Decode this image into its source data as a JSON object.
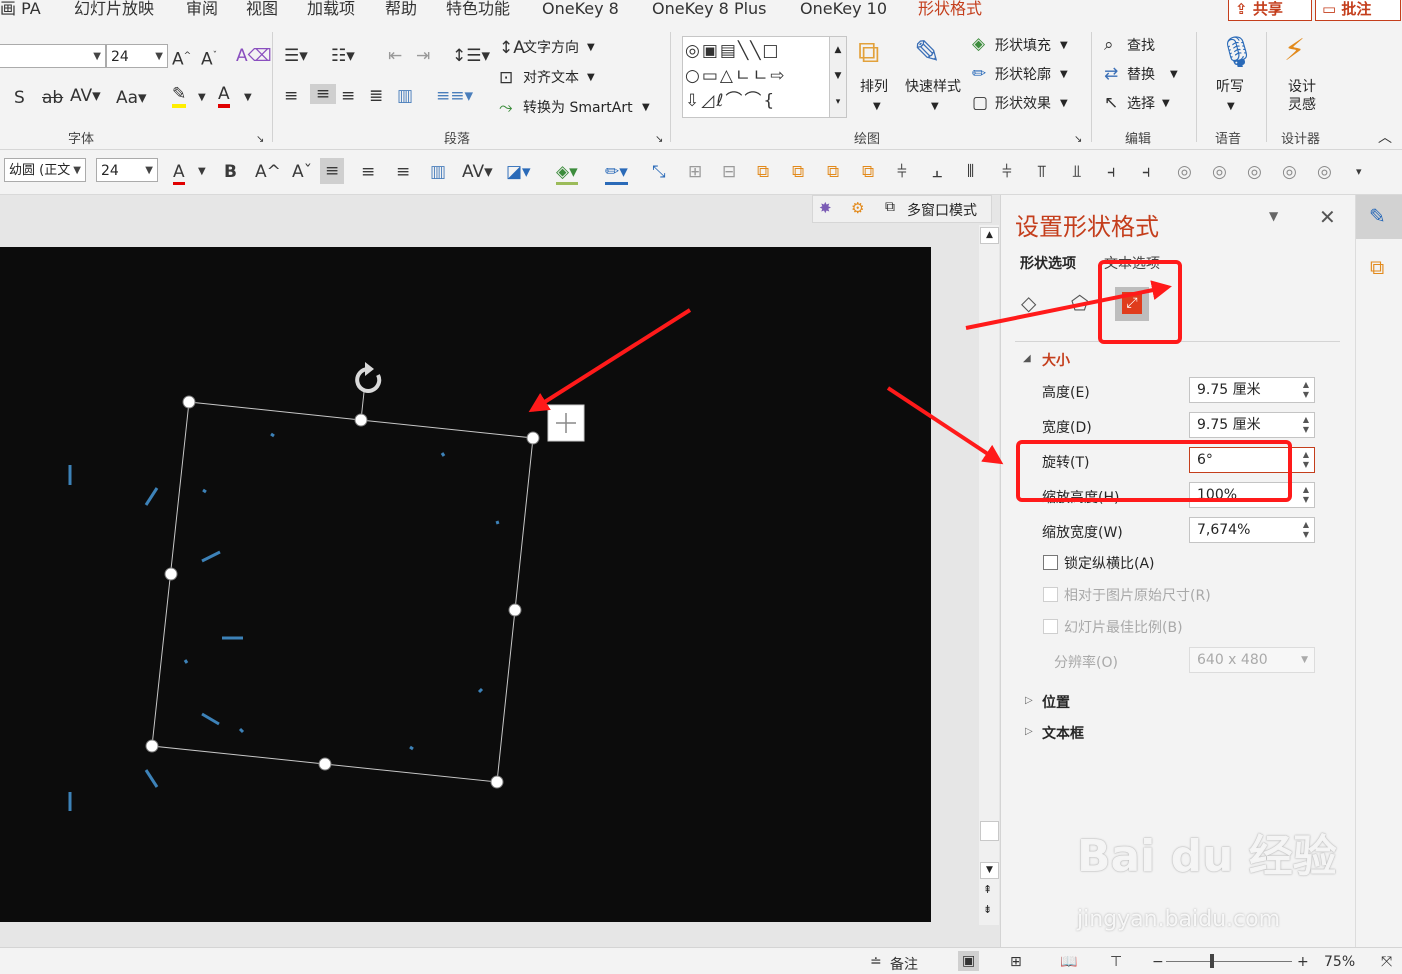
{
  "menu": {
    "tabs": [
      "画 PA",
      "幻灯片放映",
      "审阅",
      "视图",
      "加载项",
      "帮助",
      "特色功能",
      "OneKey 8",
      "OneKey 8 Plus",
      "OneKey 10",
      "形状格式"
    ],
    "active_tab": "形状格式",
    "share": "共享",
    "comment": "批注"
  },
  "ribbon": {
    "font_size": "24",
    "group_font": "字体",
    "group_paragraph": "段落",
    "group_drawing": "绘图",
    "group_editing": "编辑",
    "group_voice": "语音",
    "group_designer": "设计器",
    "text_direction": "文字方向",
    "align_text": "对齐文本",
    "convert_smartart": "转换为 SmartArt",
    "arrange": "排列",
    "quick_styles": "快速样式",
    "shape_fill": "形状填充",
    "shape_outline": "形状轮廓",
    "shape_effects": "形状效果",
    "find": "查找",
    "replace": "替换",
    "select": "选择",
    "dictate": "听写",
    "design_ideas_1": "设计",
    "design_ideas_2": "灵感"
  },
  "quick_toolbar": {
    "font_name": "幼圆 (正文",
    "font_size": "24"
  },
  "editor": {
    "multiwindow": "多窗口模式"
  },
  "pane": {
    "title": "设置形状格式",
    "tab_shape": "形状选项",
    "tab_text": "文本选项",
    "section_size": "大小",
    "height_label": "高度(E)",
    "height_value": "9.75 厘米",
    "width_label": "宽度(D)",
    "width_value": "9.75 厘米",
    "rotation_label": "旋转(T)",
    "rotation_value": "6°",
    "scale_height_label": "缩放高度(H)",
    "scale_height_value": "100%",
    "scale_width_label": "缩放宽度(W)",
    "scale_width_value": "7,674%",
    "lock_ratio": "锁定纵横比(A)",
    "relative_original": "相对于图片原始尺寸(R)",
    "best_scale": "幻灯片最佳比例(B)",
    "resolution_label": "分辨率(O)",
    "resolution_value": "640 x 480",
    "section_position": "位置",
    "section_textbox": "文本框"
  },
  "statusbar": {
    "notes": "备注",
    "zoom": "75%"
  },
  "watermark": {
    "brand": "Bai du 经验",
    "url": "jingyan.baidu.com"
  },
  "colors": {
    "accent": "#c43e1c",
    "annotation_red": "#ff1a1a",
    "slide_bg": "#0c0c0c",
    "shape_blue": "#3d82b8"
  }
}
